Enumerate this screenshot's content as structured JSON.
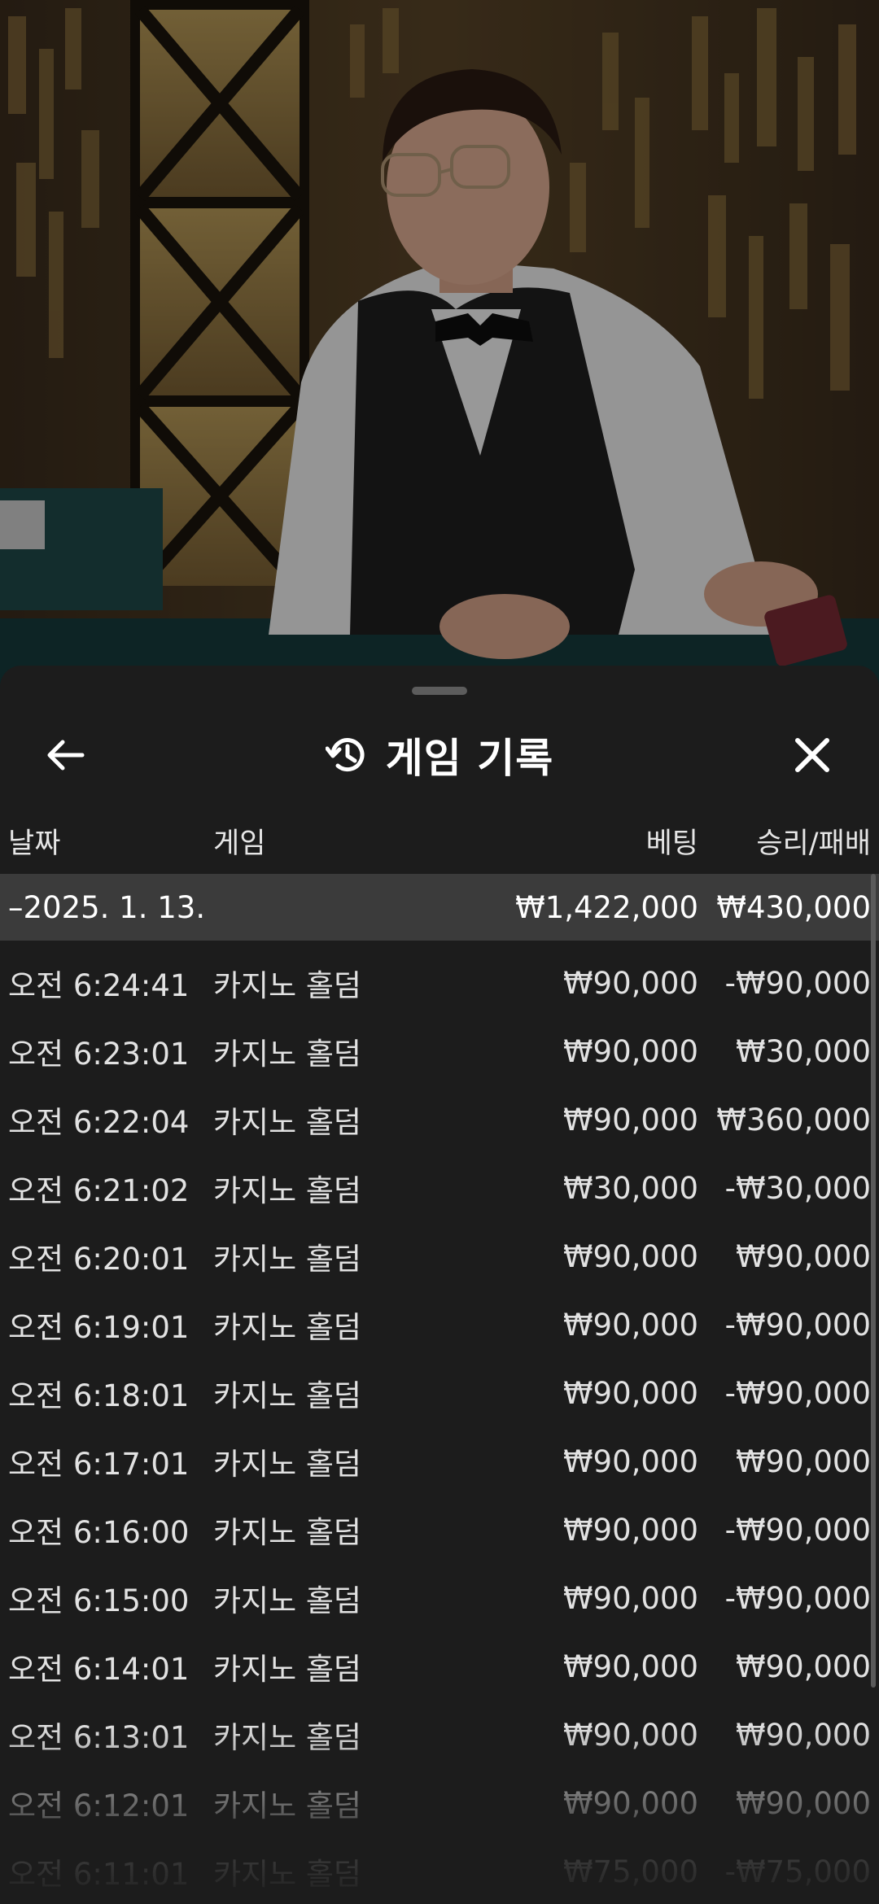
{
  "sheet": {
    "title": "게임 기록",
    "icons": {
      "back": "arrow-left-icon",
      "history": "history-icon",
      "close": "close-icon"
    }
  },
  "columns": {
    "date": "날짜",
    "game": "게임",
    "bet": "베팅",
    "win_loss": "승리/패배"
  },
  "summary": {
    "date": "–2025. 1. 13.",
    "bet": "₩1,422,000",
    "win_loss": "₩430,000"
  },
  "rows": [
    {
      "time": "오전 6:24:41",
      "game": "카지노 홀덤",
      "bet": "₩90,000",
      "win_loss": "-₩90,000"
    },
    {
      "time": "오전 6:23:01",
      "game": "카지노 홀덤",
      "bet": "₩90,000",
      "win_loss": "₩30,000"
    },
    {
      "time": "오전 6:22:04",
      "game": "카지노 홀덤",
      "bet": "₩90,000",
      "win_loss": "₩360,000"
    },
    {
      "time": "오전 6:21:02",
      "game": "카지노 홀덤",
      "bet": "₩30,000",
      "win_loss": "-₩30,000"
    },
    {
      "time": "오전 6:20:01",
      "game": "카지노 홀덤",
      "bet": "₩90,000",
      "win_loss": "₩90,000"
    },
    {
      "time": "오전 6:19:01",
      "game": "카지노 홀덤",
      "bet": "₩90,000",
      "win_loss": "-₩90,000"
    },
    {
      "time": "오전 6:18:01",
      "game": "카지노 홀덤",
      "bet": "₩90,000",
      "win_loss": "-₩90,000"
    },
    {
      "time": "오전 6:17:01",
      "game": "카지노 홀덤",
      "bet": "₩90,000",
      "win_loss": "₩90,000"
    },
    {
      "time": "오전 6:16:00",
      "game": "카지노 홀덤",
      "bet": "₩90,000",
      "win_loss": "-₩90,000"
    },
    {
      "time": "오전 6:15:00",
      "game": "카지노 홀덤",
      "bet": "₩90,000",
      "win_loss": "-₩90,000"
    },
    {
      "time": "오전 6:14:01",
      "game": "카지노 홀덤",
      "bet": "₩90,000",
      "win_loss": "₩90,000"
    },
    {
      "time": "오전 6:13:01",
      "game": "카지노 홀덤",
      "bet": "₩90,000",
      "win_loss": "₩90,000"
    },
    {
      "time": "오전 6:12:01",
      "game": "카지노 홀덤",
      "bet": "₩90,000",
      "win_loss": "₩90,000"
    },
    {
      "time": "오전 6:11:01",
      "game": "카지노 홀덤",
      "bet": "₩75,000",
      "win_loss": "-₩75,000"
    }
  ]
}
